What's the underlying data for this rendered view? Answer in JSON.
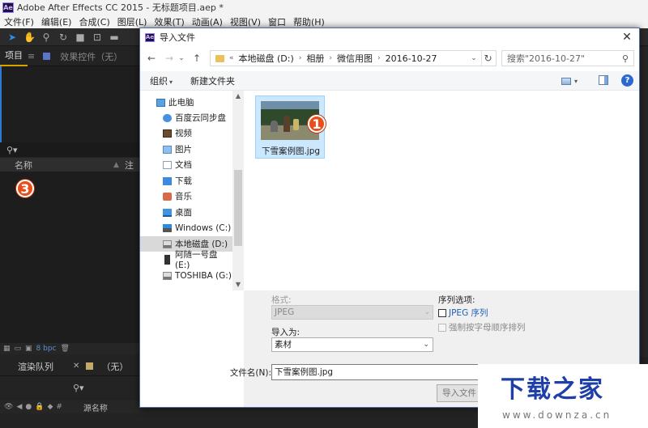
{
  "ae": {
    "title": "Adobe After Effects CC 2015 - 无标题项目.aep *",
    "logo": "Ae",
    "menu": [
      "文件(F)",
      "编辑(E)",
      "合成(C)",
      "图层(L)",
      "效果(T)",
      "动画(A)",
      "视图(V)",
      "窗口",
      "帮助(H)"
    ],
    "project_tab": "项目",
    "project_tab_menu": "≡",
    "effects_tab": "效果控件（无）",
    "col_name": "名称",
    "col_note": "注",
    "bpc": "8 bpc",
    "render_tab": "渲染队列",
    "comp_tab": "（无）",
    "source_name": "源名称"
  },
  "badges": {
    "one": "1",
    "three": "3"
  },
  "dialog": {
    "logo": "Ae",
    "title": "导入文件",
    "close": "✕",
    "breadcrumb": [
      "«",
      "本地磁盘 (D:)",
      "›",
      "相册",
      "›",
      "微信用图",
      "›",
      "2016-10-27"
    ],
    "search_placeholder": "搜索\"2016-10-27\"",
    "organize": "组织",
    "new_folder": "新建文件夹",
    "help": "?",
    "nav_items": [
      {
        "label": "此电脑",
        "icon": "computer-icon"
      },
      {
        "label": "百度云同步盘",
        "icon": "cloud-icon"
      },
      {
        "label": "视频",
        "icon": "video-icon"
      },
      {
        "label": "图片",
        "icon": "pictures-icon"
      },
      {
        "label": "文档",
        "icon": "documents-icon"
      },
      {
        "label": "下载",
        "icon": "downloads-icon"
      },
      {
        "label": "音乐",
        "icon": "music-icon"
      },
      {
        "label": "桌面",
        "icon": "desktop-icon"
      },
      {
        "label": "Windows (C:)",
        "icon": "windows-drive-icon"
      },
      {
        "label": "本地磁盘 (D:)",
        "icon": "local-drive-icon"
      },
      {
        "label": "阿随一号盘 (E:)",
        "icon": "usb-drive-icon"
      },
      {
        "label": "TOSHIBA (G:)",
        "icon": "drive-icon"
      }
    ],
    "selected_nav_index": 9,
    "file": {
      "name": "下雪案例图.jpg"
    },
    "format_label": "格式:",
    "format_value": "JPEG",
    "sequence_label": "序列选项:",
    "jpeg_sequence": "JPEG 序列",
    "force_alpha": "强制按字母顺序排列",
    "import_as_label": "导入为:",
    "import_as_value": "素材",
    "filename_label": "文件名(N):",
    "filename_value": "下雪案例图.jpg",
    "import_button": "导入文件"
  },
  "watermark": {
    "text": "下载之家",
    "url": "www.downza.cn"
  }
}
